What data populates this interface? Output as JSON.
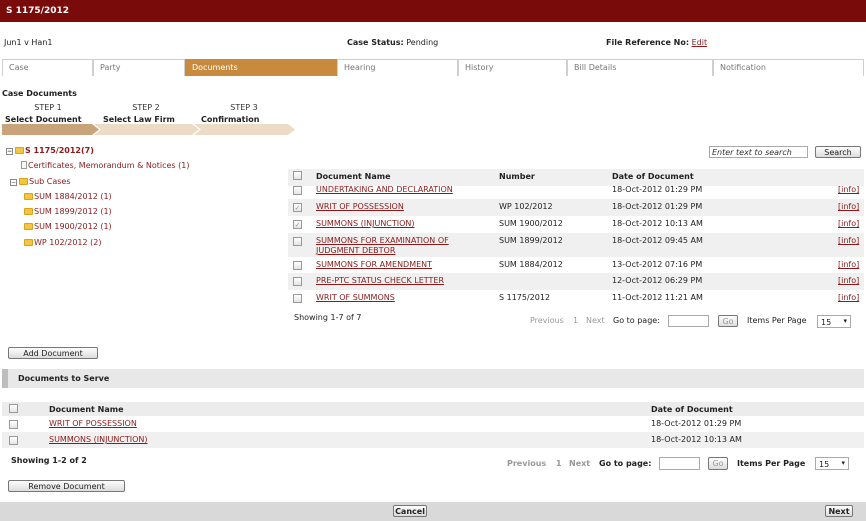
{
  "title": "S 1175/2012",
  "case_header": {
    "party": "Jun1 v Han1",
    "status_label": "Case Status:",
    "status_value": "Pending",
    "file_ref_label": "File Reference No:",
    "file_ref_link": "Edit"
  },
  "tabs": [
    {
      "label": "Case"
    },
    {
      "label": "Party"
    },
    {
      "label": "Documents"
    },
    {
      "label": "Hearing"
    },
    {
      "label": "History"
    },
    {
      "label": "Bill Details"
    },
    {
      "label": "Notification"
    }
  ],
  "case_documents_title": "Case Documents",
  "steps": [
    {
      "number": "STEP 1",
      "name": "Select Document"
    },
    {
      "number": "STEP 2",
      "name": "Select Law Firm"
    },
    {
      "number": "STEP 3",
      "name": "Confirmation"
    }
  ],
  "tree": {
    "root": "S 1175/2012(7)",
    "certificates": "Certificates, Memorandum & Notices (1)",
    "sub_cases": "Sub Cases",
    "children": [
      {
        "label": "SUM 1884/2012 (1)"
      },
      {
        "label": "SUM 1899/2012 (1)"
      },
      {
        "label": "SUM 1900/2012 (1)"
      },
      {
        "label": "WP 102/2012 (2)"
      }
    ]
  },
  "search": {
    "placeholder": "Enter text to search",
    "button": "Search"
  },
  "doc_table": {
    "headers": {
      "name": "Document Name",
      "number": "Number",
      "date": "Date of Document"
    },
    "rows": [
      {
        "name": "UNDERTAKING AND DECLARATION",
        "number": "",
        "date": "18-Oct-2012 01:29 PM",
        "info": "[info]",
        "checked": false
      },
      {
        "name": "WRIT OF POSSESSION",
        "number": "WP 102/2012",
        "date": "18-Oct-2012 01:29 PM",
        "info": "[info]",
        "checked": true
      },
      {
        "name": "SUMMONS (INJUNCTION)",
        "number": "SUM 1900/2012",
        "date": "18-Oct-2012 10:13 AM",
        "info": "[info]",
        "checked": true
      },
      {
        "name": "SUMMONS FOR EXAMINATION OF",
        "name2": "JUDGMENT DEBTOR",
        "number": "SUM 1899/2012",
        "date": "18-Oct-2012 09:45 AM",
        "info": "[info]",
        "checked": false
      },
      {
        "name": "SUMMONS FOR AMENDMENT",
        "number": "SUM 1884/2012",
        "date": "13-Oct-2012 07:16 PM",
        "info": "[info]",
        "checked": false
      },
      {
        "name": "PRE-PTC STATUS CHECK LETTER",
        "number": "",
        "date": "12-Oct-2012 06:29 PM",
        "info": "[info]",
        "checked": false
      },
      {
        "name": "WRIT OF SUMMONS",
        "number": "S 1175/2012",
        "date": "11-Oct-2012 11:21 AM",
        "info": "[info]",
        "checked": false
      }
    ],
    "showing": "Showing 1-7 of 7"
  },
  "pager": {
    "previous": "Previous",
    "page": "1",
    "next": "Next",
    "goto": "Go to page:",
    "go": "Go",
    "items_per_page": "Items Per Page",
    "per_page_value": "15"
  },
  "add_document": "Add Document",
  "serve": {
    "title": "Documents to Serve",
    "headers": {
      "name": "Document Name",
      "date": "Date of Document"
    },
    "rows": [
      {
        "name": "WRIT OF POSSESSION",
        "date": "18-Oct-2012 01:29 PM"
      },
      {
        "name": "SUMMONS (INJUNCTION)",
        "date": "18-Oct-2012 10:13 AM"
      }
    ],
    "showing": "Showing 1-2 of 2"
  },
  "remove_document": "Remove Document",
  "cancel": "Cancel",
  "next_button": "Next",
  "colors": {
    "brand": "#7a0b0b",
    "accent": "#c88a3d",
    "link": "#8b1a1a"
  },
  "icons": [
    "folder-icon",
    "document-icon",
    "expand-icon",
    "checkbox",
    "dropdown-arrow-icon"
  ]
}
